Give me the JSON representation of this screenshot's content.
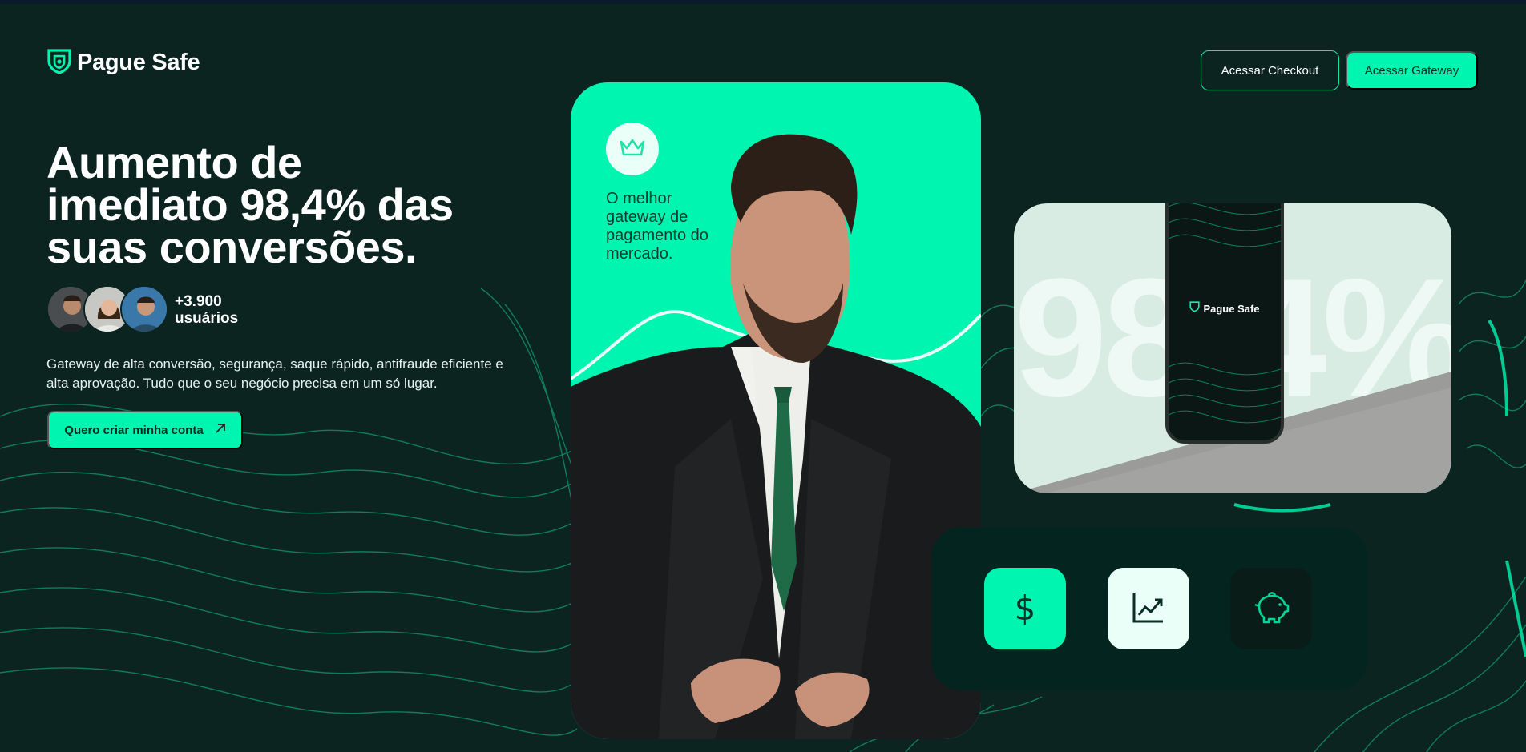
{
  "brand": {
    "name": "Pague Safe",
    "accent": "#00f5b0",
    "background": "#0c2420"
  },
  "header": {
    "checkout_label": "Acessar Checkout",
    "gateway_label": "Acessar Gateway"
  },
  "hero": {
    "title_lines": [
      "Aumento de",
      "imediato 98,4% das",
      "suas conversões."
    ],
    "users_count": "+3.900",
    "users_label": "usuários",
    "description": "Gateway de alta conversão, segurança, saque rápido, antifraude eficiente e alta aprovação. Tudo que o seu negócio precisa em um só lugar.",
    "cta_label": "Quero criar minha conta"
  },
  "card": {
    "tagline": "O melhor gateway de pagamento do mercado."
  },
  "phone_card": {
    "stat_text": "98,4%",
    "phone_logo": "Pague Safe"
  },
  "icons": [
    "dollar-icon",
    "chart-trend-icon",
    "piggy-bank-icon"
  ]
}
